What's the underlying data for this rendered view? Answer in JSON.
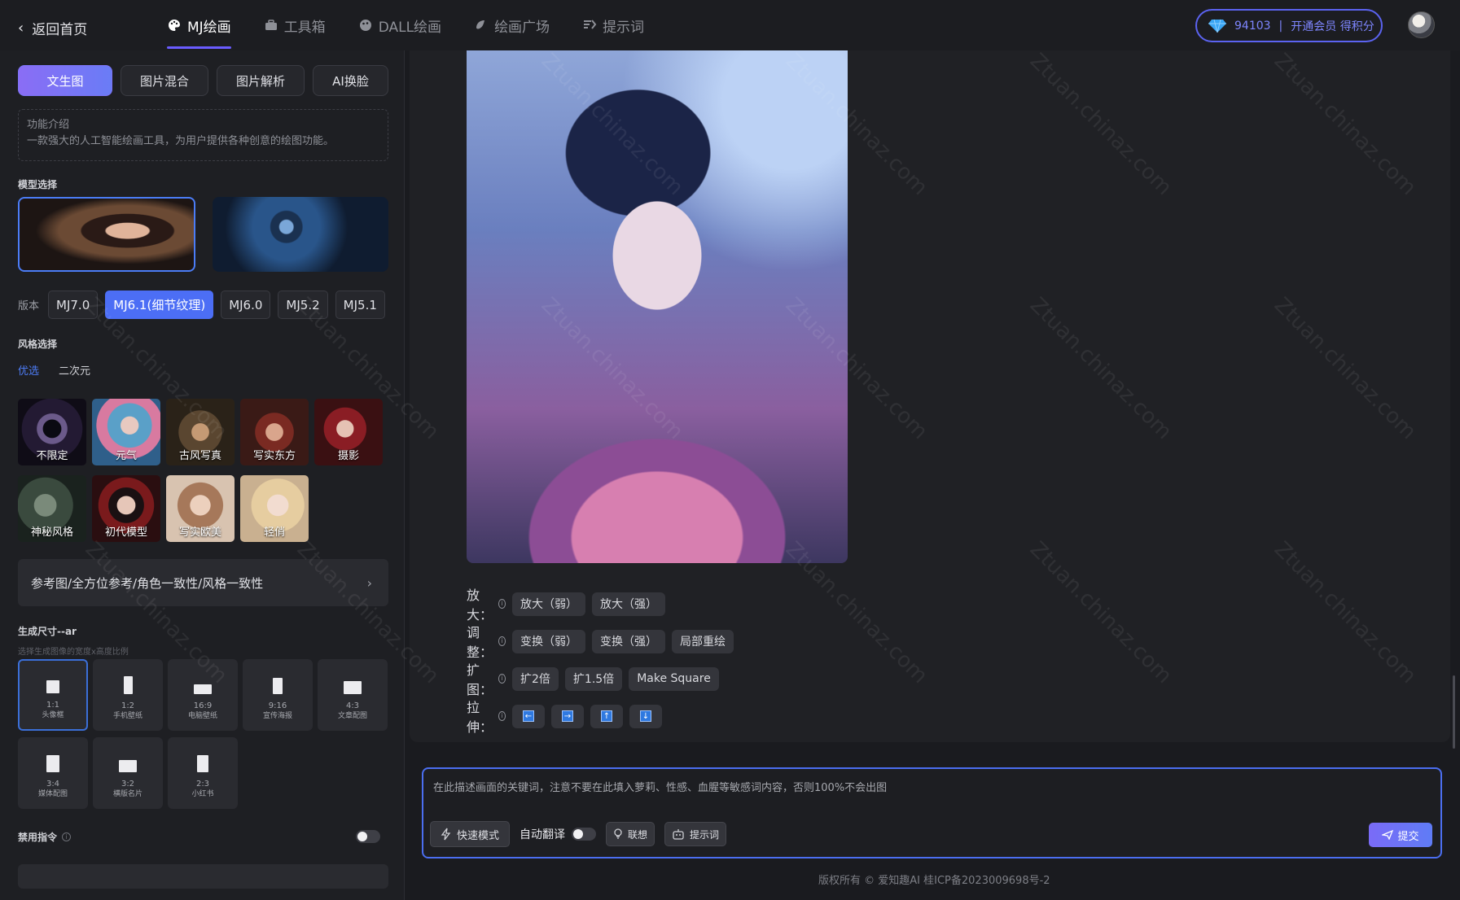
{
  "topbar": {
    "back_label": "返回首页",
    "tabs": [
      {
        "label": "MJ绘画",
        "icon": "palette-icon",
        "active": true
      },
      {
        "label": "工具箱",
        "icon": "toolbox-icon",
        "active": false
      },
      {
        "label": "DALL绘画",
        "icon": "brush-icon",
        "active": false
      },
      {
        "label": "绘画广场",
        "icon": "gallery-icon",
        "active": false
      },
      {
        "label": "提示词",
        "icon": "prompt-icon",
        "active": false
      }
    ],
    "points": "94103",
    "member_text": "开通会员 得积分",
    "accent": "#5b63f0"
  },
  "sidebar": {
    "modes": [
      "文生图",
      "图片混合",
      "图片解析",
      "AI换脸"
    ],
    "intro_title": "功能介绍",
    "intro_text": "一款强大的人工智能绘画工具，为用户提供各种创意的绘图功能。",
    "model_title": "模型选择",
    "version_label": "版本",
    "versions": [
      "MJ7.0",
      "MJ6.1(细节纹理)",
      "MJ6.0",
      "MJ5.2",
      "MJ5.1"
    ],
    "style_title": "风格选择",
    "style_tabs": [
      "优选",
      "二次元"
    ],
    "styles": [
      "不限定",
      "元气",
      "古风写真",
      "写实东方",
      "摄影",
      "神秘风格",
      "初代模型",
      "写实欧美",
      "轻俏"
    ],
    "ref_bar": "参考图/全方位参考/角色一致性/风格一致性",
    "size_title": "生成尺寸--ar",
    "size_note": "选择生成图像的宽度x高度比例",
    "sizes": [
      {
        "ratio": "1:1",
        "desc": "头像框"
      },
      {
        "ratio": "1:2",
        "desc": "手机壁纸"
      },
      {
        "ratio": "16:9",
        "desc": "电脑壁纸"
      },
      {
        "ratio": "9:16",
        "desc": "宣传海报"
      },
      {
        "ratio": "4:3",
        "desc": "文章配图"
      },
      {
        "ratio": "3:4",
        "desc": "媒体配图"
      },
      {
        "ratio": "3:2",
        "desc": "横版名片"
      },
      {
        "ratio": "2:3",
        "desc": "小红书"
      }
    ],
    "forbid_label": "禁用指令"
  },
  "main": {
    "rows": [
      {
        "label": "放大：",
        "buttons": [
          "放大（弱）",
          "放大（强）"
        ]
      },
      {
        "label": "调整：",
        "buttons": [
          "变换（弱）",
          "变换（强）",
          "局部重绘"
        ]
      },
      {
        "label": "扩图：",
        "buttons": [
          "扩2倍",
          "扩1.5倍",
          "Make Square"
        ]
      },
      {
        "label": "拉伸：",
        "arrows": [
          "←",
          "→",
          "↑",
          "↓"
        ]
      }
    ]
  },
  "composer": {
    "placeholder": "在此描述画面的关键词，注意不要在此填入萝莉、性感、血腥等敏感词内容，否则100%不会出图",
    "fast_mode": "快速模式",
    "auto_translate": "自动翻译",
    "associate": "联想",
    "prompt": "提示词",
    "submit": "提交"
  },
  "footer": "版权所有 © 爱知趣AI  桂ICP备2023009698号-2",
  "watermark": "Ztuan.chinaz.com"
}
